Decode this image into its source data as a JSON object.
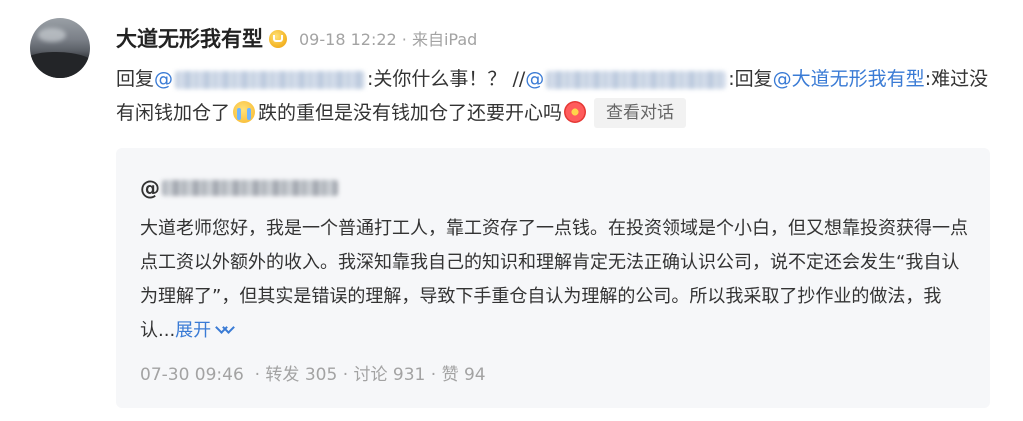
{
  "post": {
    "username": "大道无形我有型",
    "timestamp": "09-18 12:22",
    "source": "· 来自iPad",
    "reply_prefix": "回复",
    "at1": "@",
    "colon1": ":",
    "text1": "关你什么事！？ //",
    "at2": "@",
    "colon2": ":回复",
    "mention3": "@大道无形我有型",
    "text2": ":难过没有闲钱加仓了",
    "text3": "跌的重但是没有钱加仓了还要开心吗",
    "view_conversation": "查看对话"
  },
  "quoted": {
    "at": "@",
    "body": "大道老师您好，我是一个普通打工人，靠工资存了一点钱。在投资领域是个小白，但又想靠投资获得一点点工资以外额外的收入。我深知靠我自己的知识和理解肯定无法正确认识公司，说不定还会发生“我自认为理解了”，但其实是错误的理解，导致下手重仓自认为理解的公司。所以我采取了抄作业的做法，我认...",
    "expand": "展开",
    "date": "07-30 09:46",
    "repost": "· 转发 305",
    "comments": "· 讨论 931",
    "likes": "· 赞 94"
  },
  "icons": {
    "verified": "vip-badge-icon",
    "cry": "crying-emoji-icon",
    "flower": "flower-emoji-icon",
    "expand": "chevron-double-down-icon"
  },
  "colors": {
    "link": "#3a7bd5",
    "meta": "#a3a3a3",
    "card_bg": "#f6f7f9"
  }
}
